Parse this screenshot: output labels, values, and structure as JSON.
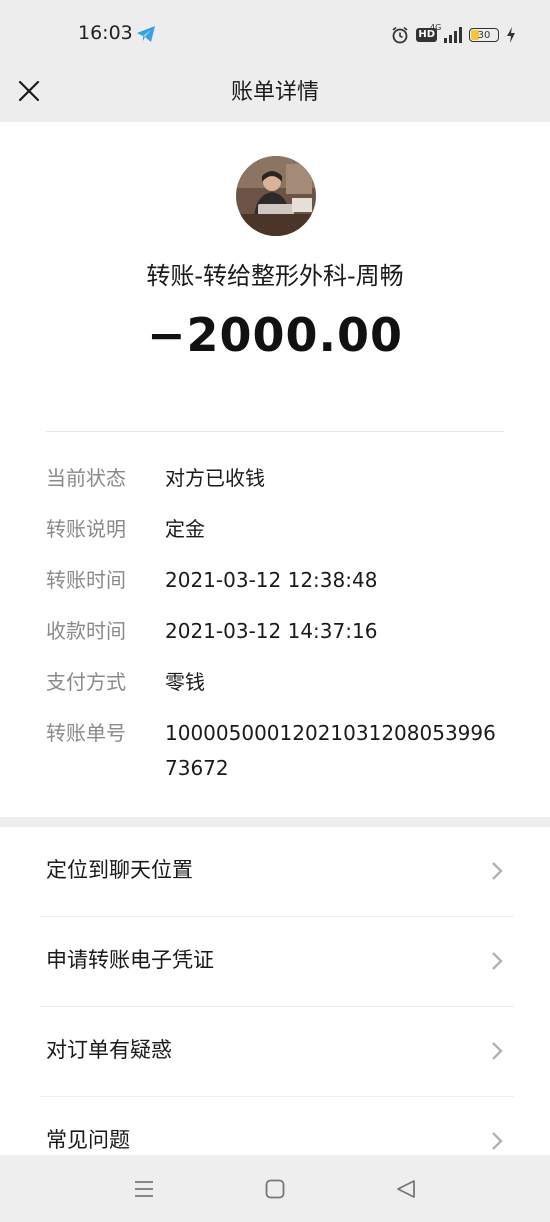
{
  "status_bar": {
    "time": "16:03",
    "network": "4G",
    "hd": "HD",
    "battery": "30",
    "icons": [
      "telegram-icon",
      "alarm-icon",
      "signal-icon",
      "battery-icon",
      "charging-icon"
    ]
  },
  "nav": {
    "title": "账单详情",
    "close_icon": "close-icon"
  },
  "transfer": {
    "payee": "转账-转给整形外科-周畅",
    "amount": "−2000.00"
  },
  "details": [
    {
      "label": "当前状态",
      "value": "对方已收钱"
    },
    {
      "label": "转账说明",
      "value": "定金"
    },
    {
      "label": "转账时间",
      "value": "2021-03-12 12:38:48"
    },
    {
      "label": "收款时间",
      "value": "2021-03-12 14:37:16"
    },
    {
      "label": "支付方式",
      "value": "零钱"
    },
    {
      "label": "转账单号",
      "value": "1000050001202103120805399673672"
    }
  ],
  "actions": [
    {
      "label": "定位到聊天位置"
    },
    {
      "label": "申请转账电子凭证"
    },
    {
      "label": "对订单有疑惑"
    },
    {
      "label": "常见问题"
    }
  ],
  "system_nav": [
    "menu-icon",
    "home-icon",
    "back-icon"
  ]
}
